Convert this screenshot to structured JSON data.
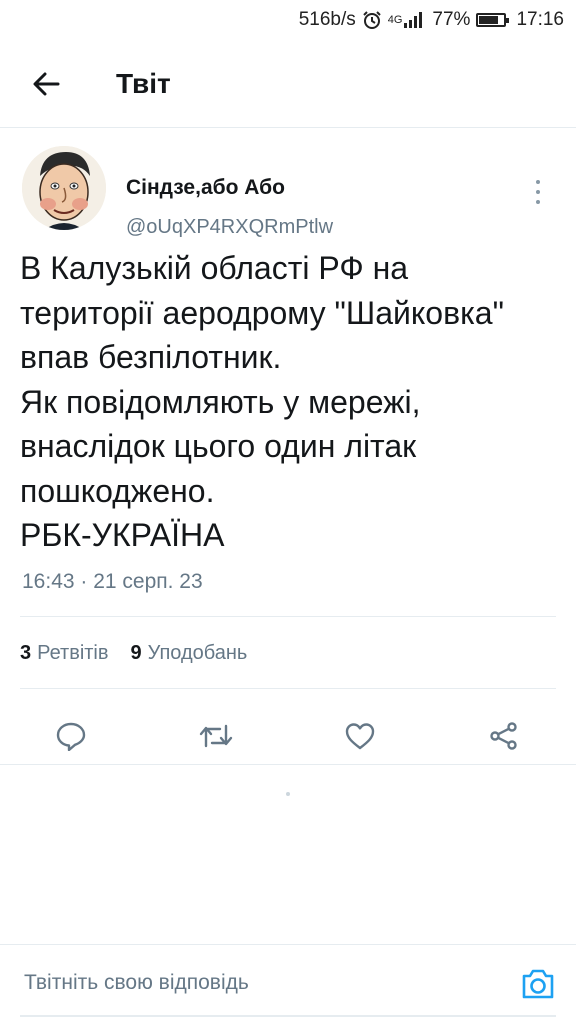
{
  "status_bar": {
    "speed": "516b/s",
    "network": "4G",
    "battery_percent": "77%",
    "battery_level": 0.77,
    "time": "17:16"
  },
  "header": {
    "title": "Твіт",
    "back_icon": "arrow-left-icon"
  },
  "tweet": {
    "author": {
      "display_name": "Сіндзе,або Або",
      "handle": "@oUqXP4RXQRmPtlw"
    },
    "text": "В Калузькій області РФ на\nтериторії аеродрому \"Шайковка\"\nвпав безпілотник.\nЯк повідомляють у мережі,\nвнаслідок цього один літак\nпошкоджено.\nРБК-УКРАЇНА",
    "timestamp": "16:43 · 21 серп. 23",
    "stats": {
      "retweets_count": "3",
      "retweets_label": "Ретвітів",
      "likes_count": "9",
      "likes_label": "Уподобань"
    },
    "actions": [
      "reply-icon",
      "retweet-icon",
      "like-icon",
      "share-icon"
    ]
  },
  "reply": {
    "placeholder": "Твітніть свою відповідь"
  },
  "colors": {
    "text_primary": "#14171a",
    "text_secondary": "#657786",
    "accent": "#1da1f2",
    "divider": "#e6ecf0"
  }
}
